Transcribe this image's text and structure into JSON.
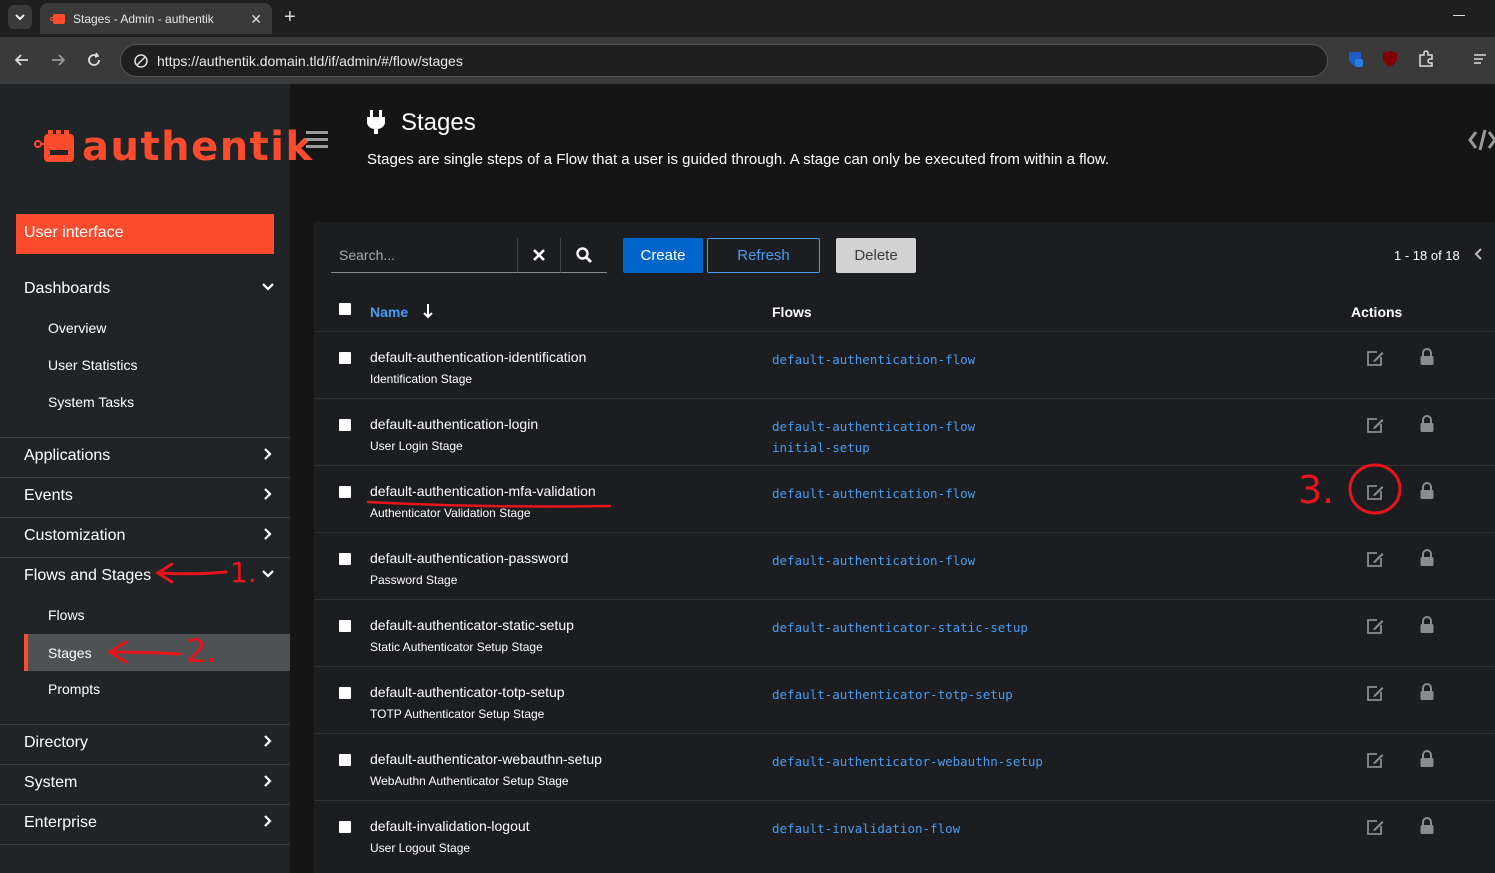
{
  "browser": {
    "tab_title": "Stages - Admin - authentik",
    "url": "https://authentik.domain.tld/if/admin/#/flow/stages",
    "tab_close": "✕",
    "new_tab": "+"
  },
  "sidebar": {
    "logo_text": "authentik",
    "ui_button": "User interface",
    "groups": [
      {
        "label": "Dashboards",
        "items": [
          "Overview",
          "User Statistics",
          "System Tasks"
        ]
      },
      {
        "label": "Applications"
      },
      {
        "label": "Events"
      },
      {
        "label": "Customization"
      },
      {
        "label": "Flows and Stages",
        "items": [
          "Flows",
          "Stages",
          "Prompts"
        ],
        "active_item": "Stages"
      },
      {
        "label": "Directory"
      },
      {
        "label": "System"
      },
      {
        "label": "Enterprise"
      }
    ]
  },
  "header": {
    "title": "Stages",
    "description": "Stages are single steps of a Flow that a user is guided through. A stage can only be executed from within a flow."
  },
  "toolbar": {
    "search_placeholder": "Search...",
    "create_label": "Create",
    "refresh_label": "Refresh",
    "delete_label": "Delete",
    "pagination": "1 - 18 of 18"
  },
  "table": {
    "columns": {
      "name": "Name",
      "flows": "Flows",
      "actions": "Actions"
    },
    "rows": [
      {
        "name": "default-authentication-identification",
        "type": "Identification Stage",
        "flows": [
          "default-authentication-flow"
        ]
      },
      {
        "name": "default-authentication-login",
        "type": "User Login Stage",
        "flows": [
          "default-authentication-flow",
          "initial-setup"
        ]
      },
      {
        "name": "default-authentication-mfa-validation",
        "type": "Authenticator Validation Stage",
        "flows": [
          "default-authentication-flow"
        ]
      },
      {
        "name": "default-authentication-password",
        "type": "Password Stage",
        "flows": [
          "default-authentication-flow"
        ]
      },
      {
        "name": "default-authenticator-static-setup",
        "type": "Static Authenticator Setup Stage",
        "flows": [
          "default-authenticator-static-setup"
        ]
      },
      {
        "name": "default-authenticator-totp-setup",
        "type": "TOTP Authenticator Setup Stage",
        "flows": [
          "default-authenticator-totp-setup"
        ]
      },
      {
        "name": "default-authenticator-webauthn-setup",
        "type": "WebAuthn Authenticator Setup Stage",
        "flows": [
          "default-authenticator-webauthn-setup"
        ]
      },
      {
        "name": "default-invalidation-logout",
        "type": "User Logout Stage",
        "flows": [
          "default-invalidation-flow"
        ]
      }
    ]
  },
  "annotations": {
    "step1": "1.",
    "step2": "2.",
    "step3": "3."
  },
  "colors": {
    "brand": "#fd4b2d",
    "link": "#4a9cf0",
    "primary_button": "#0066cc",
    "annotation": "#e8141c"
  }
}
